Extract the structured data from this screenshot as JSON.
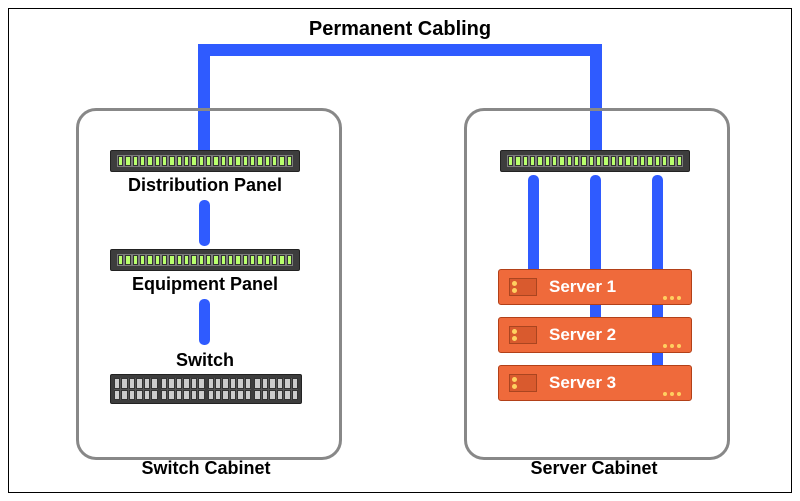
{
  "title": "Permanent Cabling",
  "colors": {
    "cable": "#2f5bff",
    "cabinet_border": "#888888",
    "rack_unit": "#3d3d3d",
    "server": "#ef6a3b"
  },
  "left_cabinet": {
    "caption": "Switch Cabinet",
    "items": [
      {
        "kind": "patch-panel",
        "label": "Distribution Panel"
      },
      {
        "kind": "patch-panel",
        "label": "Equipment Panel"
      },
      {
        "kind": "switch",
        "label": "Switch"
      }
    ]
  },
  "right_cabinet": {
    "caption": "Server Cabinet",
    "items": [
      {
        "kind": "patch-panel",
        "label": ""
      },
      {
        "kind": "server",
        "label": "Server 1"
      },
      {
        "kind": "server",
        "label": "Server 2"
      },
      {
        "kind": "server",
        "label": "Server 3"
      }
    ]
  },
  "connections": [
    {
      "from": "left_cabinet.items.0",
      "to": "right_cabinet.items.0",
      "label": "Permanent Cabling",
      "route": "top"
    },
    {
      "from": "left_cabinet.items.0",
      "to": "left_cabinet.items.1"
    },
    {
      "from": "left_cabinet.items.1",
      "to": "left_cabinet.items.2"
    },
    {
      "from": "right_cabinet.items.0",
      "to": "right_cabinet.items.1"
    },
    {
      "from": "right_cabinet.items.0",
      "to": "right_cabinet.items.2"
    },
    {
      "from": "right_cabinet.items.0",
      "to": "right_cabinet.items.3"
    }
  ]
}
